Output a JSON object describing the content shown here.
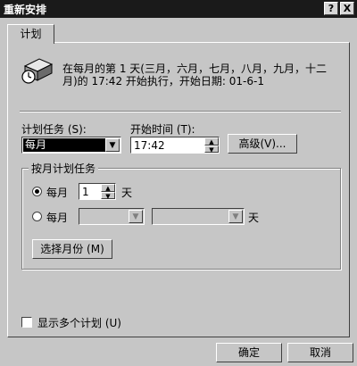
{
  "window": {
    "title": "重新安排",
    "help_button": "?",
    "close_button": "X"
  },
  "tab": {
    "label": "计划"
  },
  "summary": {
    "line1": "在每月的第 1 天(三月，六月，七月，八月，九月，十二",
    "line2": "月)的 17:42 开始执行，开始日期: 01-6-1"
  },
  "schedule": {
    "task_label": "计划任务 (S):",
    "task_value": "每月",
    "start_label": "开始时间 (T):",
    "start_value": "17:42",
    "advanced_button": "高级(V)..."
  },
  "monthly": {
    "group_label": "按月计划任务",
    "option1_label": "每月",
    "option1_day": "1",
    "option1_unit": "天",
    "option1_selected": true,
    "option2_label": "每月",
    "option2_unit": "天",
    "option2_selected": false,
    "select_months_button": "选择月份 (M)"
  },
  "show_multiple": {
    "label": "显示多个计划 (U)",
    "checked": false
  },
  "footer": {
    "ok_button": "确定",
    "cancel_button": "取消"
  },
  "colors": {
    "face": "#c6c6c6",
    "titlebar": "#1a1a1a",
    "selection": "#000000"
  },
  "icons": [
    "scheduled-task-icon",
    "spin-up-icon",
    "spin-down-icon",
    "dropdown-arrow-icon"
  ]
}
